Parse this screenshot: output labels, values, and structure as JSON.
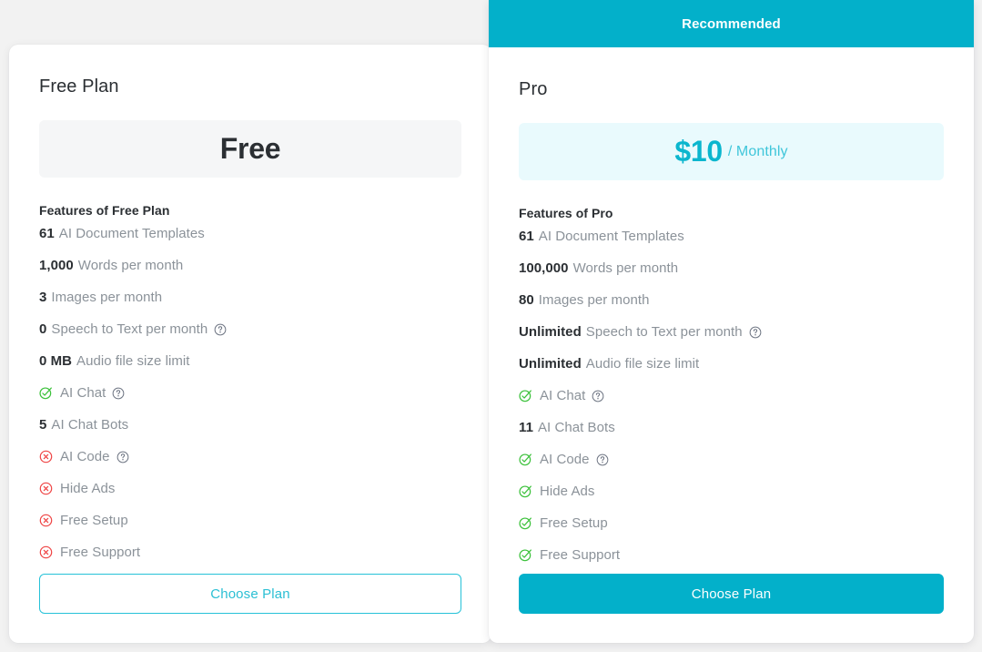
{
  "page": {
    "background_color": "#f2f2f2",
    "accent_color": "#03b0ca",
    "positive_color": "#3cc13b",
    "negative_color": "#ef4444",
    "muted_text_color": "#8b9299"
  },
  "plans": [
    {
      "id": "free",
      "name": "Free Plan",
      "recommended": false,
      "recommended_label": "",
      "price": "Free",
      "price_period": "",
      "features_heading": "Features of Free Plan",
      "features": [
        {
          "kind": "value",
          "value": "61",
          "label": "AI Document Templates",
          "help": false
        },
        {
          "kind": "value",
          "value": "1,000",
          "label": "Words per month",
          "help": false
        },
        {
          "kind": "value",
          "value": "3",
          "label": "Images per month",
          "help": false
        },
        {
          "kind": "value",
          "value": "0",
          "label": "Speech to Text per month",
          "help": true
        },
        {
          "kind": "value",
          "value": "0 MB",
          "label": "Audio file size limit",
          "help": false
        },
        {
          "kind": "included",
          "value": "",
          "label": "AI Chat",
          "help": true
        },
        {
          "kind": "value",
          "value": "5",
          "label": "AI Chat Bots",
          "help": false
        },
        {
          "kind": "excluded",
          "value": "",
          "label": "AI Code",
          "help": true
        },
        {
          "kind": "excluded",
          "value": "",
          "label": "Hide Ads",
          "help": false
        },
        {
          "kind": "excluded",
          "value": "",
          "label": "Free Setup",
          "help": false
        },
        {
          "kind": "excluded",
          "value": "",
          "label": "Free Support",
          "help": false
        }
      ],
      "cta_label": "Choose Plan"
    },
    {
      "id": "pro",
      "name": "Pro",
      "recommended": true,
      "recommended_label": "Recommended",
      "price": "$10",
      "price_period": "/ Monthly",
      "features_heading": "Features of Pro",
      "features": [
        {
          "kind": "value",
          "value": "61",
          "label": "AI Document Templates",
          "help": false
        },
        {
          "kind": "value",
          "value": "100,000",
          "label": "Words per month",
          "help": false
        },
        {
          "kind": "value",
          "value": "80",
          "label": "Images per month",
          "help": false
        },
        {
          "kind": "value",
          "value": "Unlimited",
          "label": "Speech to Text per month",
          "help": true
        },
        {
          "kind": "value",
          "value": "Unlimited",
          "label": "Audio file size limit",
          "help": false
        },
        {
          "kind": "included",
          "value": "",
          "label": "AI Chat",
          "help": true
        },
        {
          "kind": "value",
          "value": "11",
          "label": "AI Chat Bots",
          "help": false
        },
        {
          "kind": "included",
          "value": "",
          "label": "AI Code",
          "help": true
        },
        {
          "kind": "included",
          "value": "",
          "label": "Hide Ads",
          "help": false
        },
        {
          "kind": "included",
          "value": "",
          "label": "Free Setup",
          "help": false
        },
        {
          "kind": "included",
          "value": "",
          "label": "Free Support",
          "help": false
        }
      ],
      "cta_label": "Choose Plan"
    }
  ],
  "icons": {
    "included": "check-circle-icon",
    "excluded": "x-circle-icon",
    "help": "question-circle-icon"
  }
}
